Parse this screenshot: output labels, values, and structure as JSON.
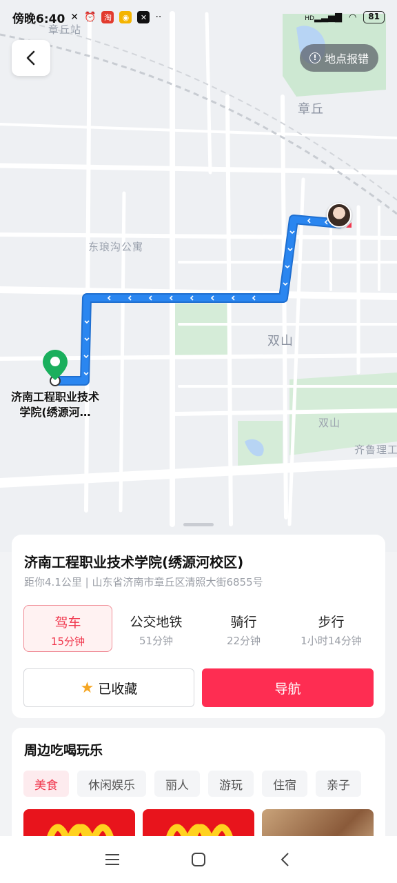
{
  "status_bar": {
    "time": "傍晚6:40",
    "battery": "81",
    "network": "HD"
  },
  "map": {
    "labels": {
      "zhangqiu_station": "章丘站",
      "zhangqiu": "章丘",
      "donglanggou": "东琅沟公寓",
      "shuangshan_big": "双山",
      "shuangshan_small": "双山",
      "qilu": "齐鲁理工"
    },
    "report_button": "地点报错",
    "destination_label": "济南工程职业技术学院(绣源河…"
  },
  "colors": {
    "accent": "#fe2d52",
    "route": "#2a86f0",
    "pin": "#1aaf5d"
  },
  "place": {
    "title": "济南工程职业技术学院(绣源河校区)",
    "address": "距你4.1公里 | 山东省济南市章丘区清照大街6855号"
  },
  "modes": [
    {
      "name": "驾车",
      "time": "15分钟",
      "active": true
    },
    {
      "name": "公交地铁",
      "time": "51分钟",
      "active": false
    },
    {
      "name": "骑行",
      "time": "22分钟",
      "active": false
    },
    {
      "name": "步行",
      "time": "1小时14分钟",
      "active": false
    }
  ],
  "actions": {
    "favorite": "已收藏",
    "navigate": "导航"
  },
  "nearby": {
    "title": "周边吃喝玩乐",
    "chips": [
      "美食",
      "休闲娱乐",
      "丽人",
      "游玩",
      "住宿",
      "亲子"
    ]
  },
  "icons": [
    "back-icon",
    "info-icon",
    "star-icon",
    "location-pin-icon",
    "user-avatar-icon",
    "menu-icon",
    "home-icon",
    "back-nav-icon"
  ]
}
